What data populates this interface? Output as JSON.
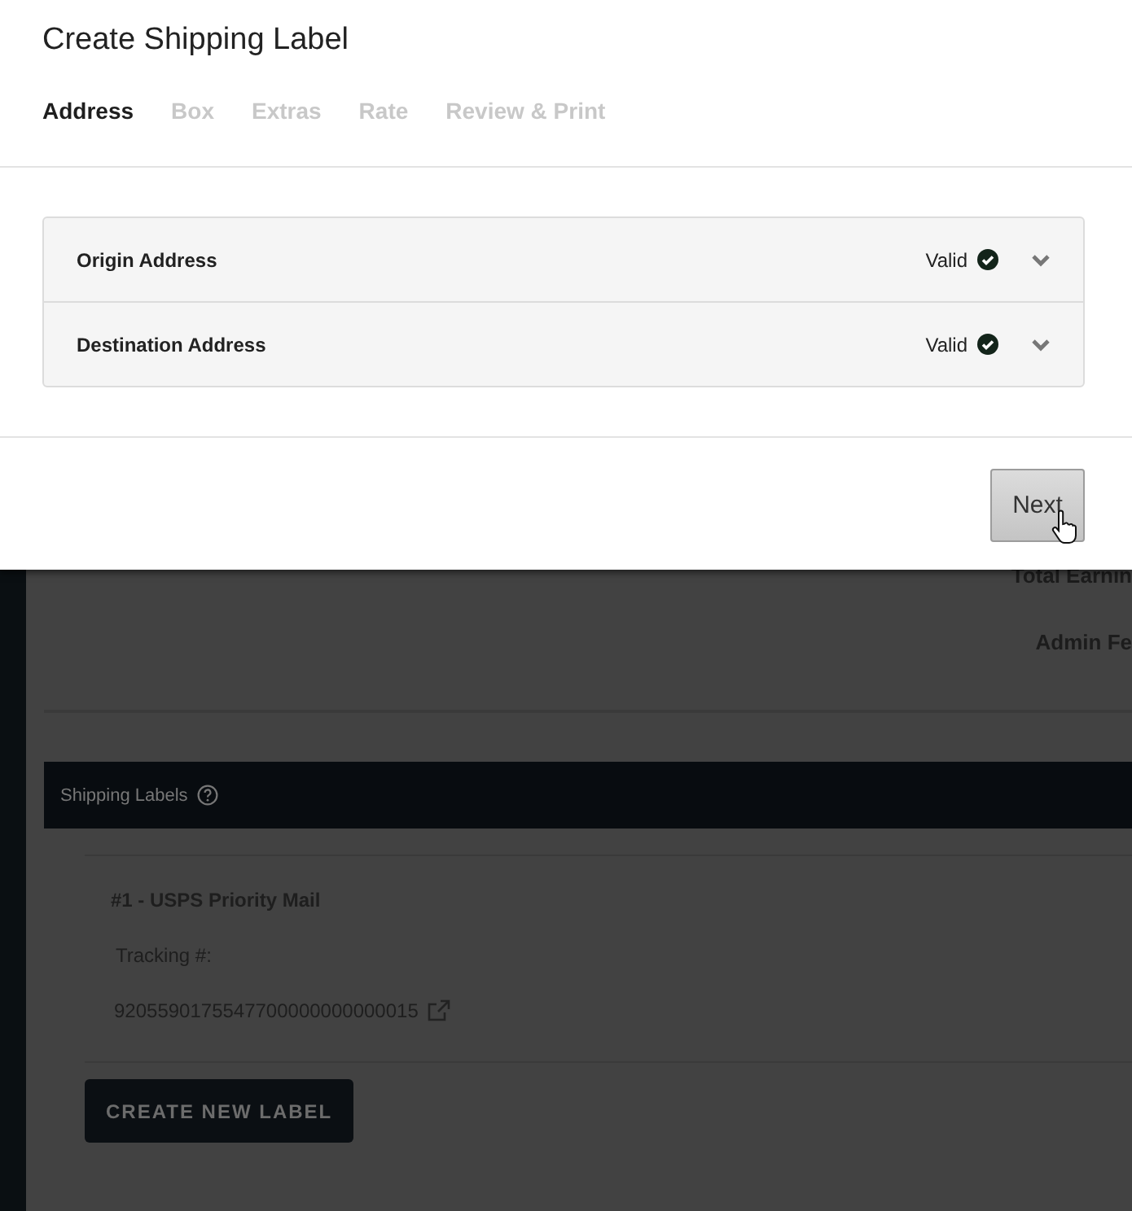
{
  "dialog": {
    "title": "Create Shipping Label",
    "steps": [
      {
        "label": "Address",
        "selected": true
      },
      {
        "label": "Box",
        "selected": false
      },
      {
        "label": "Extras",
        "selected": false
      },
      {
        "label": "Rate",
        "selected": false
      },
      {
        "label": "Review & Print",
        "selected": false
      }
    ],
    "sections": [
      {
        "title": "Origin Address",
        "status": "Valid",
        "valid": true
      },
      {
        "title": "Destination Address",
        "status": "Valid",
        "valid": true
      }
    ],
    "next_button": "Next"
  },
  "background_page": {
    "summary": [
      "Total Earnin",
      "Admin Fe"
    ],
    "shipping_labels": {
      "title": "Shipping Labels",
      "labels": [
        {
          "title": "#1 - USPS Priority Mail",
          "tracking_label": "Tracking #:",
          "tracking_number": "9205590175547700000000000015"
        }
      ],
      "create_button": "CREATE NEW LABEL"
    }
  }
}
